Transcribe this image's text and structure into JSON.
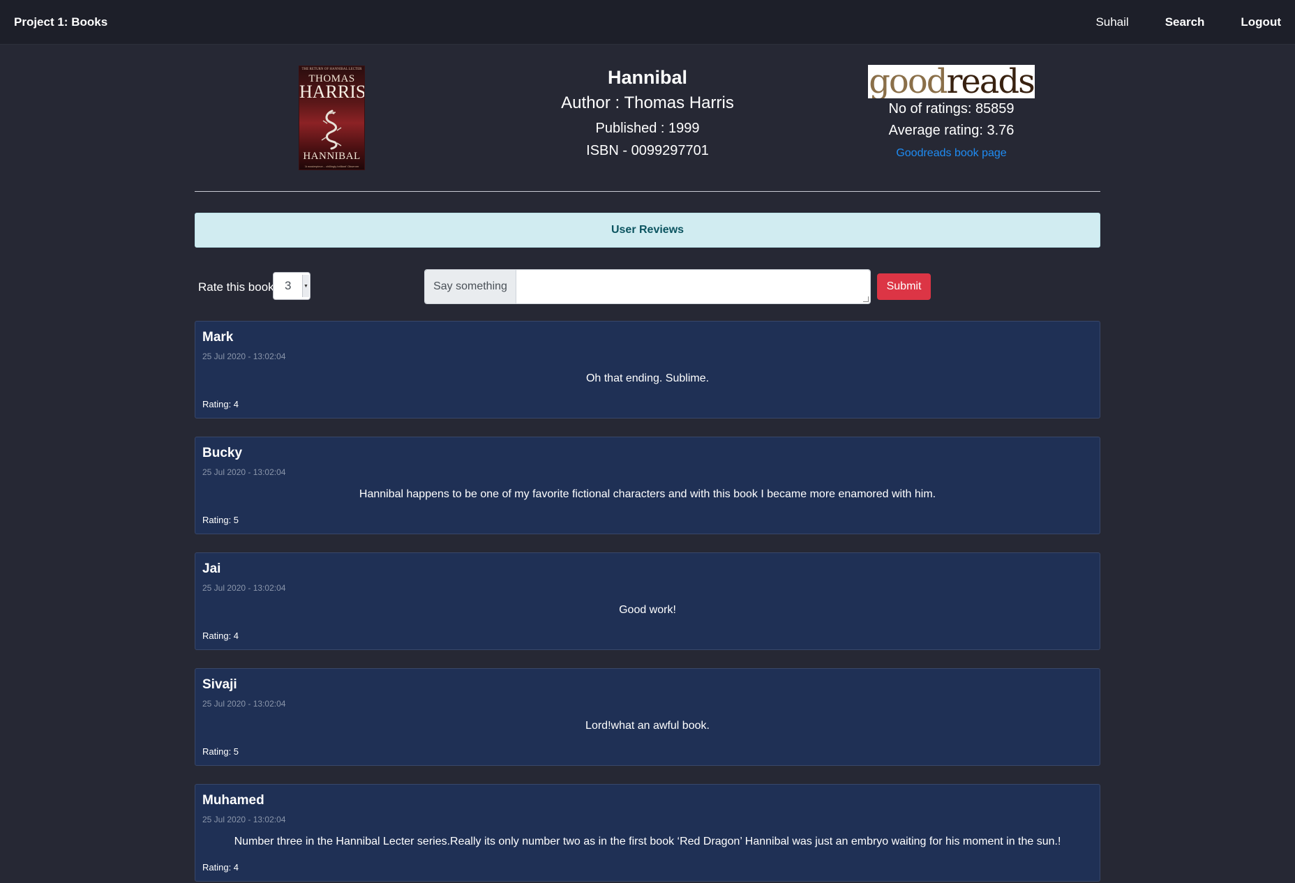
{
  "nav": {
    "brand": "Project 1: Books",
    "user": "Suhail",
    "search": "Search",
    "logout": "Logout"
  },
  "book": {
    "title": "Hannibal",
    "author_line": "Author : Thomas Harris",
    "published_line": "Published : 1999",
    "isbn_line": "ISBN - 0099297701",
    "cover": {
      "top_text": "THE RETURN OF HANNIBAL LECTER",
      "author_first": "THOMAS",
      "author_last": "HARRIS",
      "title": "HANNIBAL",
      "quote": "'A masterpiece... chillingly brilliant' Observer"
    }
  },
  "goodreads": {
    "logo_light": "good",
    "logo_dark": "reads",
    "ratings_count_line": "No of ratings: 85859",
    "average_rating_line": "Average rating: 3.76",
    "link_label": "Goodreads book page"
  },
  "reviews_section": {
    "title": "User Reviews"
  },
  "form": {
    "rate_label": "Rate this book",
    "rating_value": "3",
    "comment_prefix": "Say something",
    "comment_value": "",
    "submit_label": "Submit"
  },
  "reviews": [
    {
      "name": "Mark",
      "time": "25 Jul 2020 - 13:02:04",
      "text": "Oh that ending. Sublime.",
      "rating": "Rating: 4"
    },
    {
      "name": "Bucky",
      "time": "25 Jul 2020 - 13:02:04",
      "text": "Hannibal happens to be one of my favorite fictional characters and with this book I became more enamored with him.",
      "rating": "Rating: 5"
    },
    {
      "name": "Jai",
      "time": "25 Jul 2020 - 13:02:04",
      "text": "Good work!",
      "rating": "Rating: 4"
    },
    {
      "name": "Sivaji",
      "time": "25 Jul 2020 - 13:02:04",
      "text": "Lord!what an awful book.",
      "rating": "Rating: 5"
    },
    {
      "name": "Muhamed",
      "time": "25 Jul 2020 - 13:02:04",
      "text": "Number three in the Hannibal Lecter series.Really its only number two as in the first book ‘Red Dragon’ Hannibal was just an embryo waiting for his moment in the sun.!",
      "rating": "Rating: 4"
    }
  ],
  "colors": {
    "page_bg": "#262834",
    "navbar_bg": "#1d1f29",
    "card_bg": "#1f3055",
    "banner_bg": "#d1ecf1",
    "banner_text": "#0c5460",
    "submit_bg": "#dc3545",
    "link": "#1f8cf3"
  }
}
